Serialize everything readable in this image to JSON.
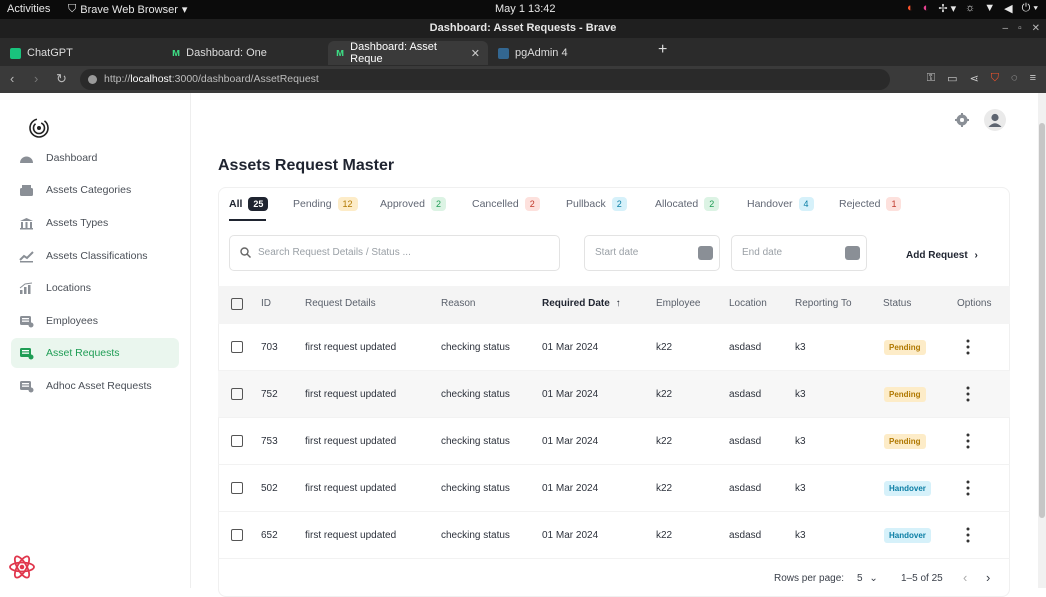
{
  "system": {
    "activities": "Activities",
    "app_menu": "Brave Web Browser",
    "clock": "May 1  13:42"
  },
  "window": {
    "title": "Dashboard: Asset Requests - Brave"
  },
  "browser": {
    "tabs": [
      {
        "label": "ChatGPT",
        "favicon_color": "#19c37d"
      },
      {
        "label": "Dashboard: One",
        "favicon_color": "#3ddc84"
      },
      {
        "label": "Dashboard: Asset Reque",
        "favicon_color": "#3ddc84"
      },
      {
        "label": "pgAdmin 4",
        "favicon_color": "#336791"
      }
    ],
    "url_prefix": "http://",
    "url_host": "localhost",
    "url_rest": ":3000/dashboard/AssetRequest"
  },
  "sidebar": {
    "items": [
      {
        "label": "Dashboard",
        "icon": "gauge-icon"
      },
      {
        "label": "Assets Categories",
        "icon": "layers-icon"
      },
      {
        "label": "Assets Types",
        "icon": "bank-icon"
      },
      {
        "label": "Assets Classifications",
        "icon": "classification-icon"
      },
      {
        "label": "Locations",
        "icon": "chart-icon"
      },
      {
        "label": "Employees",
        "icon": "employees-icon"
      },
      {
        "label": "Asset Requests",
        "icon": "requests-icon"
      },
      {
        "label": "Adhoc Asset Requests",
        "icon": "adhoc-icon"
      }
    ],
    "active_index": 6
  },
  "page": {
    "title": "Assets Request Master",
    "filter_tabs": [
      {
        "label": "All",
        "count": "25"
      },
      {
        "label": "Pending",
        "count": "12"
      },
      {
        "label": "Approved",
        "count": "2"
      },
      {
        "label": "Cancelled",
        "count": "2"
      },
      {
        "label": "Pullback",
        "count": "2"
      },
      {
        "label": "Allocated",
        "count": "2"
      },
      {
        "label": "Handover",
        "count": "4"
      },
      {
        "label": "Rejected",
        "count": "1"
      }
    ],
    "search_placeholder": "Search Request Details / Status ...",
    "start_date_placeholder": "Start date",
    "end_date_placeholder": "End date",
    "add_request_label": "Add Request",
    "columns": [
      "ID",
      "Request Details",
      "Reason",
      "Required Date",
      "Employee",
      "Location",
      "Reporting To",
      "Status",
      "Options"
    ],
    "rows": [
      {
        "id": "703",
        "details": "first request updated",
        "reason": "checking status",
        "date": "01 Mar 2024",
        "employee": "k22",
        "location": "asdasd",
        "reporting": "k3",
        "status": "Pending"
      },
      {
        "id": "752",
        "details": "first request updated",
        "reason": "checking status",
        "date": "01 Mar 2024",
        "employee": "k22",
        "location": "asdasd",
        "reporting": "k3",
        "status": "Pending"
      },
      {
        "id": "753",
        "details": "first request updated",
        "reason": "checking status",
        "date": "01 Mar 2024",
        "employee": "k22",
        "location": "asdasd",
        "reporting": "k3",
        "status": "Pending"
      },
      {
        "id": "502",
        "details": "first request updated",
        "reason": "checking status",
        "date": "01 Mar 2024",
        "employee": "k22",
        "location": "asdasd",
        "reporting": "k3",
        "status": "Handover"
      },
      {
        "id": "652",
        "details": "first request updated",
        "reason": "checking status",
        "date": "01 Mar 2024",
        "employee": "k22",
        "location": "asdasd",
        "reporting": "k3",
        "status": "Handover"
      }
    ],
    "rows_per_page_label": "Rows per page:",
    "rows_per_page_value": "5",
    "range_label": "1–5 of 25"
  },
  "colors": {
    "active_green": "#1f9d55",
    "active_bg": "#eaf6ee",
    "pending_bg": "#fdecc8",
    "handover_bg": "#d6f1fa"
  }
}
